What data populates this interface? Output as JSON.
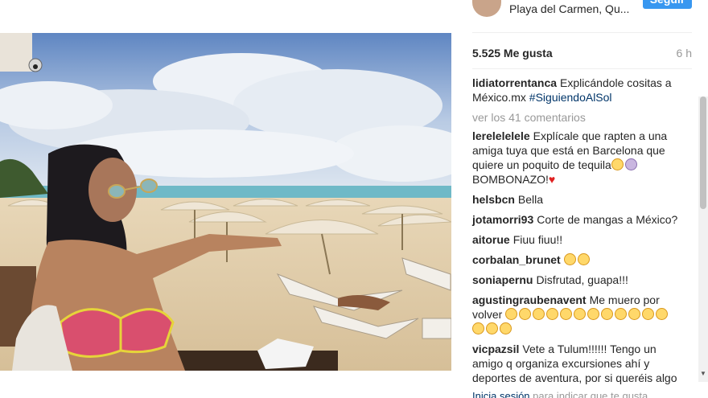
{
  "header": {
    "location": "Playa del Carmen, Qu...",
    "follow_label": "Seguir"
  },
  "post": {
    "likes": "5.525 Me gusta",
    "time": "6 h",
    "caption_user": "lidiatorrentanca",
    "caption_text": "Explicándole cositas a México.mx",
    "caption_tag": "#SiguiendoAlSol",
    "view_comments": "ver los 41 comentarios"
  },
  "comments": [
    {
      "user": "lerelelelele",
      "text": "Explícale que rapten a una amiga tuya que está en Barcelona que quiere un poquito de tequila",
      "suffix": "BOMBONAZO!"
    },
    {
      "user": "helsbcn",
      "text": "Bella"
    },
    {
      "user": "jotamorri93",
      "text": "Corte de mangas a México?"
    },
    {
      "user": "aitorue",
      "text": "Fiuu fiuu!!"
    },
    {
      "user": "corbalan_brunet",
      "text": ""
    },
    {
      "user": "soniapernu",
      "text": "Disfrutad, guapa!!!"
    },
    {
      "user": "agustingraubenavent",
      "text": "Me muero por volver"
    },
    {
      "user": "vicpazsil",
      "text": "Vete a Tulum!!!!!! Tengo un amigo q organiza excursiones ahí y deportes de aventura, por si queréis algo"
    }
  ],
  "footer": {
    "login_link": "Inicia sesión",
    "login_text": "para indicar que te gusta"
  },
  "icons": {
    "emoji": "laughing-emoji-icon",
    "heart": "heart-icon",
    "woman": "woman-emoji-icon"
  },
  "colors": {
    "follow_button": "#3897f0",
    "link": "#003569",
    "muted": "#999999"
  }
}
